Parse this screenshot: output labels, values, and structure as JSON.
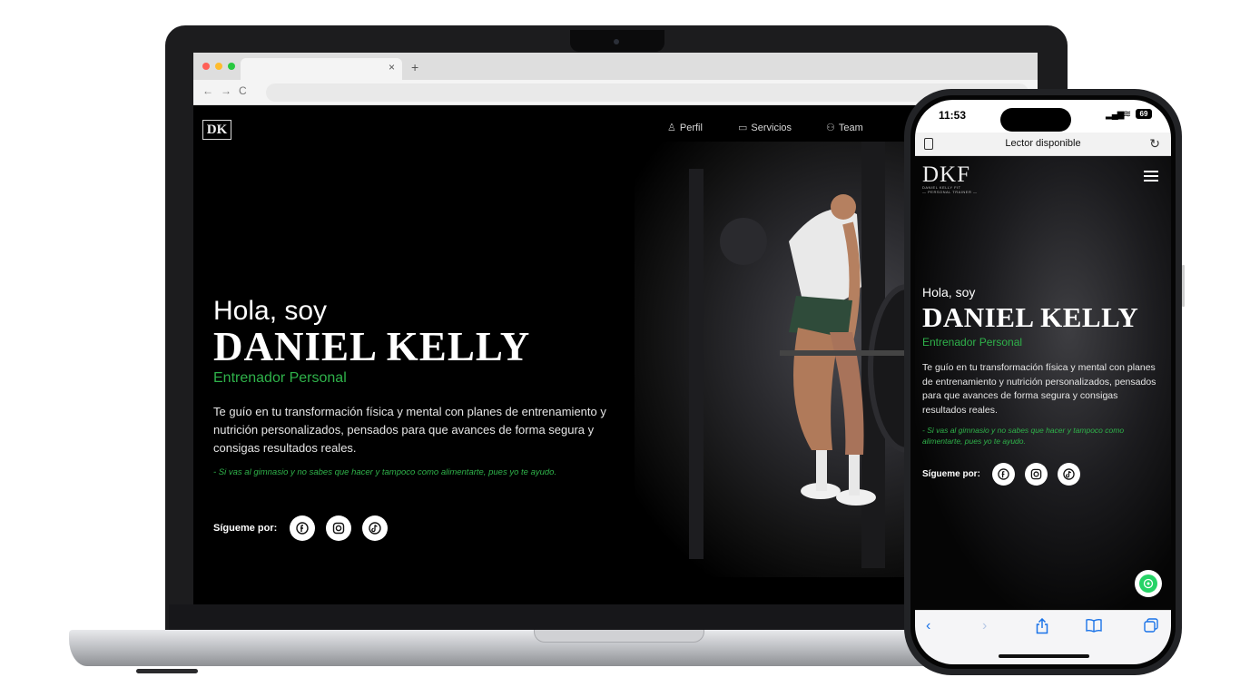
{
  "laptop": {
    "site": {
      "logo": "DK",
      "nav": [
        {
          "label": "Perfil",
          "icon": "person-icon"
        },
        {
          "label": "Servicios",
          "icon": "briefcase-icon"
        },
        {
          "label": "Team",
          "icon": "team-icon"
        }
      ],
      "hero": {
        "greeting": "Hola, soy",
        "name": "DANIEL KELLY",
        "role": "Entrenador Personal",
        "description": "Te guío en tu transformación física y mental con planes de entrenamiento y nutrición personalizados, pensados para que avances de forma segura y consigas resultados reales.",
        "quote": "- Si vas al gimnasio y no sabes que hacer y tampoco como alimentarte, pues yo te ayudo.",
        "follow_label": "Sígueme por:",
        "socials": [
          "facebook-icon",
          "instagram-icon",
          "tiktok-icon"
        ]
      }
    },
    "browser": {
      "tab_close": "×",
      "new_tab": "+",
      "back": "←",
      "forward": "→",
      "reload": "C"
    }
  },
  "phone": {
    "status": {
      "time": "11:53",
      "battery": "69"
    },
    "browser": {
      "reader_text": "Lector disponible"
    },
    "site": {
      "logo": "DKF",
      "logo_sub": "DANIEL KELLY FIT",
      "logo_tag": "— PERSONAL TRAINER —",
      "hero": {
        "greeting": "Hola, soy",
        "name": "DANIEL KELLY",
        "role": "Entrenador Personal",
        "description": "Te guío en tu transformación física y mental con planes de entrenamiento y nutrición personalizados, pensados para que avances de forma segura y consigas resultados reales.",
        "quote": "- Si vas al gimnasio y no sabes que hacer y tampoco como alimentarte, pues yo te ayudo.",
        "follow_label": "Sígueme por:"
      }
    },
    "toolbar": {
      "back": "‹",
      "forward": "›"
    }
  },
  "colors": {
    "accent": "#2fb24a",
    "background": "#000000",
    "whatsapp": "#25d366"
  }
}
